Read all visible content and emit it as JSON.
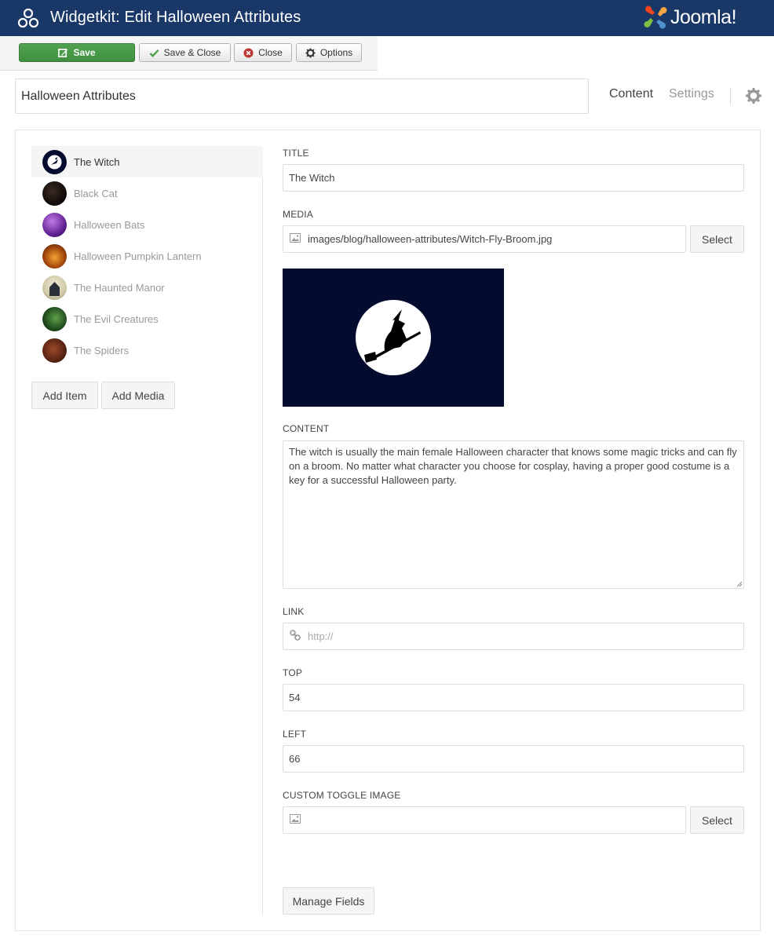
{
  "header": {
    "title": "Widgetkit: Edit Halloween Attributes",
    "brand": "Joomla!",
    "brand_color": "#1a3867"
  },
  "toolbar": {
    "save_label": "Save",
    "save_close_label": "Save & Close",
    "close_label": "Close",
    "options_label": "Options"
  },
  "widget_title": "Halloween Attributes",
  "tabs": {
    "content": "Content",
    "settings": "Settings",
    "active": "Content"
  },
  "items": [
    {
      "label": "The Witch",
      "active": true,
      "thumb": "witch"
    },
    {
      "label": "Black Cat",
      "active": false,
      "thumb": "cat"
    },
    {
      "label": "Halloween Bats",
      "active": false,
      "thumb": "bats"
    },
    {
      "label": "Halloween Pumpkin Lantern",
      "active": false,
      "thumb": "pumpkin"
    },
    {
      "label": "The Haunted Manor",
      "active": false,
      "thumb": "manor"
    },
    {
      "label": "The Evil Creatures",
      "active": false,
      "thumb": "creatures"
    },
    {
      "label": "The Spiders",
      "active": false,
      "thumb": "spiders"
    }
  ],
  "item_actions": {
    "add_item": "Add Item",
    "add_media": "Add Media"
  },
  "form": {
    "title_label": "Title",
    "title_value": "The Witch",
    "media_label": "Media",
    "media_value": "images/blog/halloween-attributes/Witch-Fly-Broom.jpg",
    "select_label": "Select",
    "content_label": "Content",
    "content_value": "The witch is usually the main female Halloween character that knows some magic tricks and can fly on a broom. No matter what character you choose for cosplay, having a proper good costume is a key for a successful Halloween party.",
    "link_label": "Link",
    "link_placeholder": "http://",
    "top_label": "Top",
    "top_value": "54",
    "left_label": "Left",
    "left_value": "66",
    "toggle_label": "Custom Toggle Image",
    "toggle_value": "",
    "manage_fields": "Manage Fields"
  }
}
